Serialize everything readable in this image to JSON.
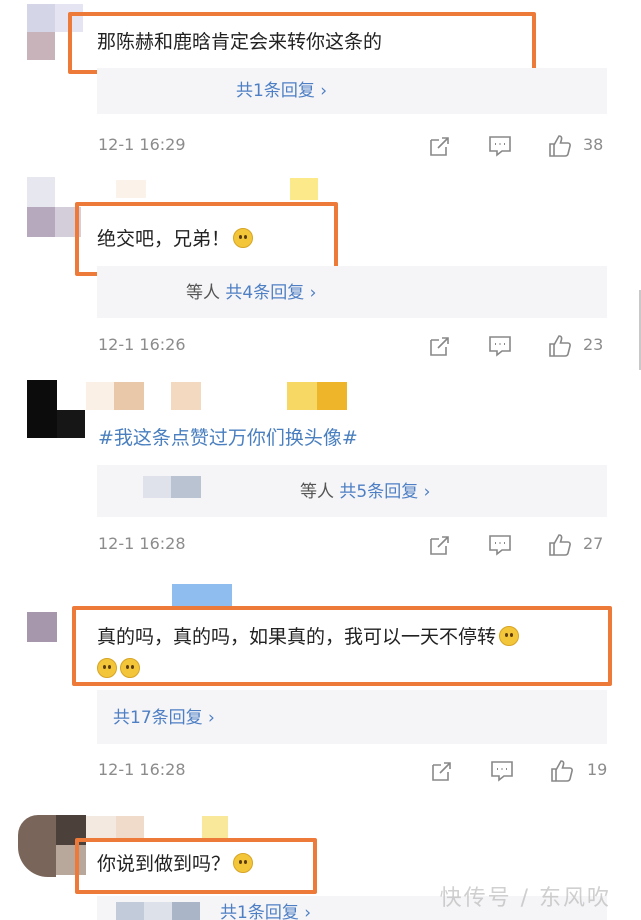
{
  "comments": [
    {
      "text": "那陈赫和鹿晗肯定会来转你这条的",
      "reply_prefix": "",
      "reply_link": "共1条回复 ›",
      "time": "12-1 16:29",
      "likes": "38"
    },
    {
      "text": "绝交吧，兄弟！",
      "reply_prefix": "等人",
      "reply_link": "共4条回复 ›",
      "time": "12-1 16:26",
      "likes": "23"
    },
    {
      "text": "#我这条点赞过万你们换头像#",
      "reply_prefix": "等人",
      "reply_link": "共5条回复 ›",
      "time": "12-1 16:28",
      "likes": "27"
    },
    {
      "text": "真的吗，真的吗，如果真的，我可以一天不停转",
      "reply_prefix": "",
      "reply_link": "共17条回复 ›",
      "time": "12-1 16:28",
      "likes": "19"
    },
    {
      "text": "你说到做到吗？",
      "reply_prefix": "",
      "reply_link": "共1条回复 ›",
      "time": "",
      "likes": ""
    }
  ],
  "watermark": "快传号 / 东风吹",
  "icons": {
    "share": "share-icon",
    "comment": "comment-icon",
    "like": "thumbs-up-icon"
  },
  "colors": {
    "highlight": "#ee7a3a",
    "link": "#4e7fc4",
    "hashtag": "#4a7fbf",
    "meta": "#8c8c8c"
  }
}
